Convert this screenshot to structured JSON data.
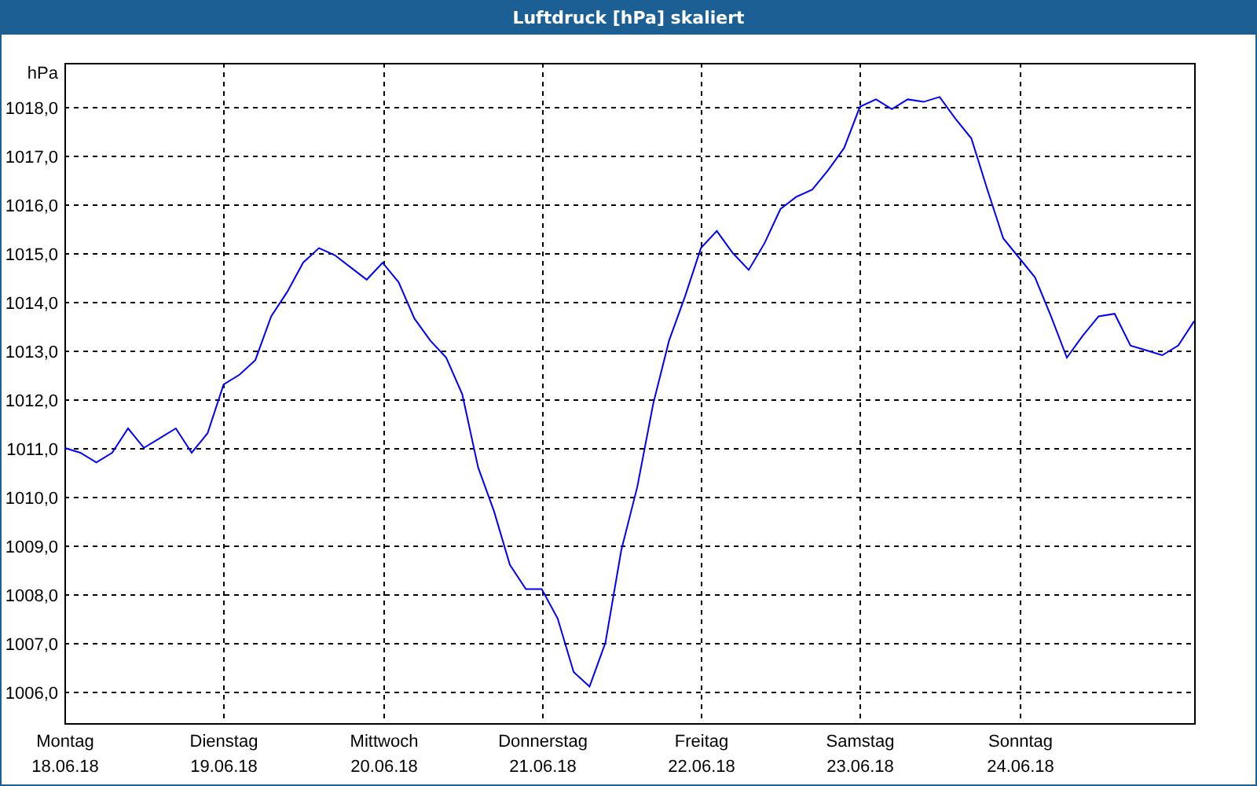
{
  "window": {
    "title": "Luftdruck [hPa] skaliert"
  },
  "chart": {
    "chart_data": {
      "type": "line",
      "grid": true,
      "ylabel": "hPa",
      "ylim": [
        1005.35,
        1018.9
      ],
      "yticks": [
        {
          "value": 1006,
          "label": "1006,0"
        },
        {
          "value": 1007,
          "label": "1007,0"
        },
        {
          "value": 1008,
          "label": "1008,0"
        },
        {
          "value": 1009,
          "label": "1009,0"
        },
        {
          "value": 1010,
          "label": "1010,0"
        },
        {
          "value": 1011,
          "label": "1011,0"
        },
        {
          "value": 1012,
          "label": "1012,0"
        },
        {
          "value": 1013,
          "label": "1013,0"
        },
        {
          "value": 1014,
          "label": "1014,0"
        },
        {
          "value": 1015,
          "label": "1015,0"
        },
        {
          "value": 1016,
          "label": "1016,0"
        },
        {
          "value": 1017,
          "label": "1017,0"
        },
        {
          "value": 1018,
          "label": "1018,0"
        }
      ],
      "categories": [
        "Montag 18.06.18",
        null,
        null,
        null,
        null,
        null,
        null,
        null,
        null,
        null,
        "Dienstag 19.06.18",
        null,
        null,
        null,
        null,
        null,
        null,
        null,
        null,
        null,
        "Mittwoch 20.06.18",
        null,
        null,
        null,
        null,
        null,
        null,
        null,
        null,
        null,
        "Donnerstag 21.06.18",
        null,
        null,
        null,
        null,
        null,
        null,
        null,
        null,
        null,
        "Freitag 22.06.18",
        null,
        null,
        null,
        null,
        null,
        null,
        null,
        null,
        null,
        "Samstag 23.06.18",
        null,
        null,
        null,
        null,
        null,
        null,
        null,
        null,
        null,
        "Sonntag 24.06.18",
        null,
        null,
        null,
        null,
        null,
        null,
        null,
        null,
        null,
        null,
        null
      ],
      "series": [
        {
          "color": "#0000ff",
          "values": [
            1011.0,
            1010.9,
            1010.7,
            1010.9,
            1011.4,
            1011.0,
            1011.2,
            1011.4,
            1010.9,
            1011.3,
            1012.3,
            1012.5,
            1012.8,
            1013.7,
            1014.2,
            1014.8,
            1015.1,
            1014.95,
            1014.7,
            1014.45,
            1014.8,
            1014.4,
            1013.65,
            1013.2,
            1012.85,
            1012.1,
            1010.6,
            1009.7,
            1008.6,
            1008.1,
            1008.1,
            1007.5,
            1006.4,
            1006.1,
            1007.0,
            1008.9,
            1010.2,
            1011.9,
            1013.2,
            1014.1,
            1015.1,
            1015.45,
            1015.0,
            1014.65,
            1015.2,
            1015.9,
            1016.15,
            1016.3,
            1016.7,
            1017.15,
            1018.0,
            1018.15,
            1017.95,
            1018.15,
            1018.1,
            1018.2,
            1017.75,
            1017.35,
            1016.3,
            1015.3,
            1014.9,
            1014.5,
            1013.7,
            1012.85,
            1013.3,
            1013.7,
            1013.75,
            1013.1,
            1013.0,
            1012.9,
            1013.1,
            1013.6
          ]
        }
      ]
    }
  }
}
